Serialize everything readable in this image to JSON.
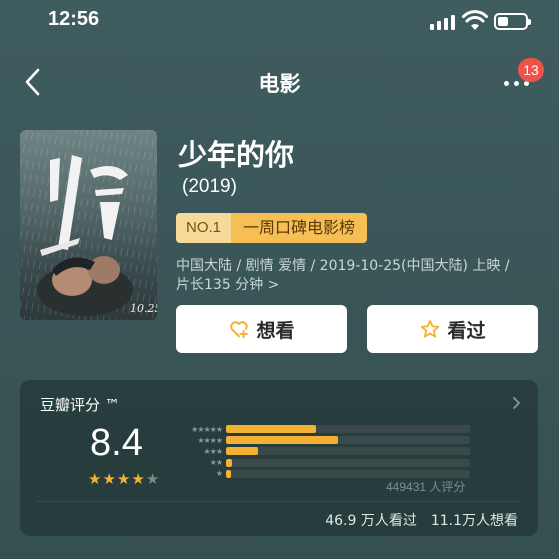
{
  "status_bar": {
    "time": "12:56",
    "icons": [
      "signal-icon",
      "wifi-icon",
      "battery-icon"
    ]
  },
  "nav": {
    "title": "电影",
    "back_icon": "chevron-left-icon",
    "more_icon": "more-dots-icon",
    "badge_count": "13"
  },
  "movie": {
    "title": "少年的你",
    "year": "(2019)",
    "rank_no": "NO.1",
    "rank_name": "一周口碑电影榜",
    "meta_line1": "中国大陆 / 剧情 爱情 / 2019-10-25(中国大陆) 上映 /",
    "meta_line2": "片长135 分钟 >"
  },
  "actions": {
    "want_label": "想看",
    "seen_label": "看过",
    "want_icon": "heart-plus-icon",
    "seen_icon": "star-outline-icon"
  },
  "rating": {
    "title": "豆瓣评分 ™",
    "score": "8.4",
    "stars_filled": 4,
    "stars_total": 5,
    "distribution": [
      {
        "stars": 5,
        "fraction": 0.37
      },
      {
        "stars": 4,
        "fraction": 0.46
      },
      {
        "stars": 3,
        "fraction": 0.13
      },
      {
        "stars": 2,
        "fraction": 0.025
      },
      {
        "stars": 1,
        "fraction": 0.02
      }
    ],
    "count_text": "449431 人评分",
    "seen_text": "46.9 万人看过",
    "want_text": "11.1万人想看"
  },
  "colors": {
    "background": "#3a5658",
    "accent_gold": "#f5b134",
    "tag_light": "#f7d99a",
    "tag_dark": "#f5bf55",
    "badge_red": "#f0524a"
  }
}
